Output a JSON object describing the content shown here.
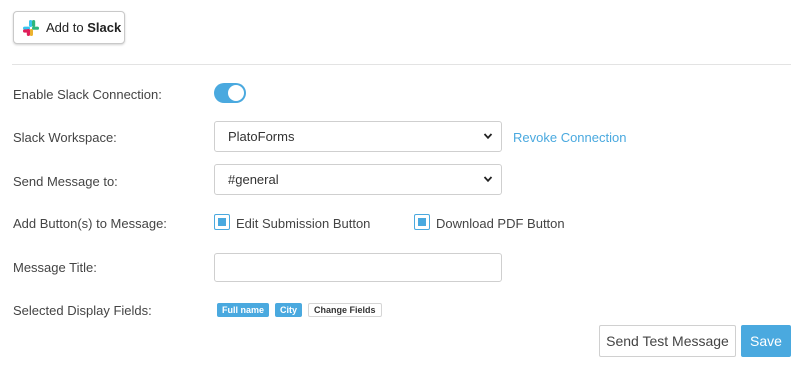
{
  "slack_button": {
    "prefix": "Add to",
    "brand": "Slack",
    "icon": "slack-logo-icon"
  },
  "fields": {
    "enable": {
      "label": "Enable Slack Connection:",
      "enabled": true
    },
    "workspace": {
      "label": "Slack Workspace:",
      "selected": "PlatoForms",
      "revoke_link": "Revoke Connection"
    },
    "send_to": {
      "label": "Send Message to:",
      "selected": "#general"
    },
    "buttons": {
      "label": "Add Button(s) to Message:",
      "options": [
        {
          "label": "Edit Submission Button",
          "checked": true
        },
        {
          "label": "Download PDF Button",
          "checked": true
        }
      ]
    },
    "title": {
      "label": "Message Title:",
      "value": "",
      "placeholder": ""
    },
    "display_fields": {
      "label": "Selected Display Fields:",
      "tags": [
        "Full name",
        "City"
      ],
      "change_label": "Change Fields"
    }
  },
  "actions": {
    "test_label": "Send Test Message",
    "save_label": "Save"
  },
  "colors": {
    "accent": "#4aa9df",
    "border": "#cfcfcf",
    "text": "#444444"
  }
}
